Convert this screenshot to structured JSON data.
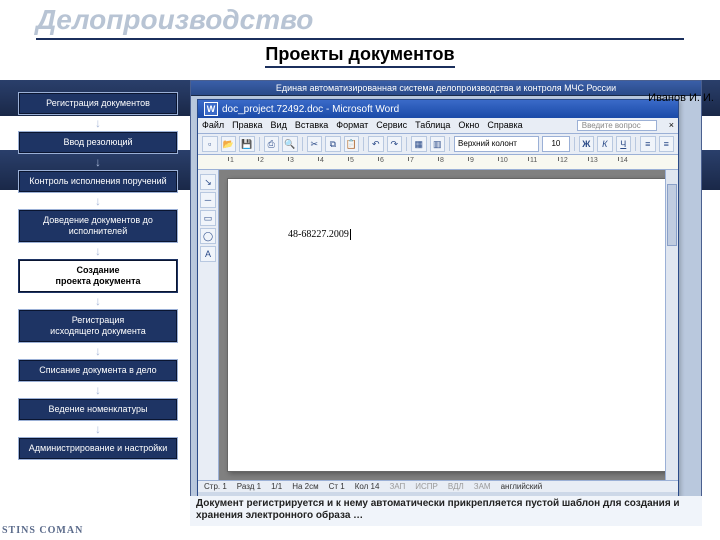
{
  "page": {
    "title": "Делопроизводство",
    "subtitle": "Проекты документов"
  },
  "sidebar": {
    "items": [
      {
        "label": "Регистрация документов"
      },
      {
        "label": "Ввод резолюций"
      },
      {
        "label": "Контроль исполнения поручений"
      },
      {
        "label": "Доведение документов до исполнителей"
      },
      {
        "label": "Создание\nпроекта документа"
      },
      {
        "label": "Регистрация\nисходящего документа"
      },
      {
        "label": "Списание документа в дело"
      },
      {
        "label": "Ведение номенклатуры"
      },
      {
        "label": "Администрирование и настройки"
      }
    ]
  },
  "system": {
    "header": "Единая автоматизированная система делопроизводства и контроля МЧС России",
    "user": "Иванов И. И."
  },
  "word": {
    "titlebar": "doc_project.72492.doc - Microsoft Word",
    "menu": [
      "Файл",
      "Правка",
      "Вид",
      "Вставка",
      "Формат",
      "Сервис",
      "Таблица",
      "Окно",
      "Справка"
    ],
    "question_placeholder": "Введите вопрос",
    "style_field": "Верхний колонт",
    "size_field": "10",
    "bold": "Ж",
    "italic": "К",
    "underline": "Ч",
    "doc_text": "48-68227.2009",
    "status": {
      "page": "Стр. 1",
      "section": "Разд 1",
      "pages": "1/1",
      "at": "На 2см",
      "line": "Ст 1",
      "col": "Кол 14",
      "rec": "ЗАП",
      "trk": "ИСПР",
      "ext": "ВДЛ",
      "ovr": "ЗАМ",
      "lang": "английский"
    }
  },
  "caption": {
    "text": "Документ регистрируется и к нему автоматически прикрепляется пустой шаблон для создания и хранения электронного образа …"
  },
  "footer": {
    "brand1": "STINS",
    "brand2": "COMAN"
  }
}
